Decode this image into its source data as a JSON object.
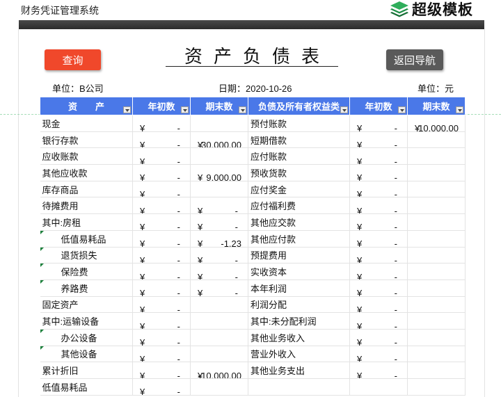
{
  "app": {
    "title": "财务凭证管理系统",
    "brand": "超级模板"
  },
  "buttons": {
    "query": "查询",
    "nav": "返回导航"
  },
  "document": {
    "title": "资产负债表",
    "unit_left": "单位：B公司",
    "date": "日期：2020-10-26",
    "unit_right": "单位：元"
  },
  "table": {
    "headers": [
      "资　　产",
      "年初数",
      "期末数",
      "负债及所有者权益类",
      "年初数",
      "期末数"
    ],
    "rows": [
      {
        "asset": "现金",
        "a_begin": [
          "¥",
          "-"
        ],
        "a_end": [
          "",
          ""
        ],
        "liab": "预付账款",
        "l_begin": [
          "¥",
          "-"
        ],
        "l_end": [
          "¥",
          "10,000.00"
        ]
      },
      {
        "asset": "银行存款",
        "a_begin": [
          "¥",
          "-"
        ],
        "a_end": [
          "¥",
          "30,000.00"
        ],
        "liab": "短期借款",
        "l_begin": [
          "¥",
          "-"
        ],
        "l_end": [
          "",
          ""
        ]
      },
      {
        "asset": "应收账款",
        "a_begin": [
          "¥",
          "-"
        ],
        "a_end": [
          "",
          ""
        ],
        "liab": "应付账款",
        "l_begin": [
          "¥",
          "-"
        ],
        "l_end": [
          "",
          ""
        ]
      },
      {
        "asset": "其他应收款",
        "a_begin": [
          "¥",
          "-"
        ],
        "a_end": [
          "¥",
          "9,000.00"
        ],
        "liab": "预收货款",
        "l_begin": [
          "¥",
          "-"
        ],
        "l_end": [
          "",
          ""
        ]
      },
      {
        "asset": "库存商品",
        "a_begin": [
          "¥",
          "-"
        ],
        "a_end": [
          "",
          ""
        ],
        "liab": "应付奖金",
        "l_begin": [
          "¥",
          "-"
        ],
        "l_end": [
          "",
          ""
        ]
      },
      {
        "asset": "待摊费用",
        "a_begin": [
          "¥",
          "-"
        ],
        "a_end": [
          "¥",
          "-"
        ],
        "liab": "应付福利费",
        "l_begin": [
          "¥",
          "-"
        ],
        "l_end": [
          "",
          ""
        ]
      },
      {
        "asset": "其中:房租",
        "a_begin": [
          "¥",
          "-"
        ],
        "a_end": [
          "¥",
          "-"
        ],
        "liab": "其他应交款",
        "l_begin": [
          "¥",
          "-"
        ],
        "l_end": [
          "",
          ""
        ]
      },
      {
        "asset": "低值易耗品",
        "a_begin": [
          "¥",
          "-"
        ],
        "a_end": [
          "¥",
          "-1.23"
        ],
        "liab": "其他应付款",
        "l_begin": [
          "¥",
          "-"
        ],
        "l_end": [
          "",
          ""
        ]
      },
      {
        "asset": "退货损失",
        "a_begin": [
          "¥",
          "-"
        ],
        "a_end": [
          "¥",
          "-"
        ],
        "liab": "预提费用",
        "l_begin": [
          "¥",
          "-"
        ],
        "l_end": [
          "",
          ""
        ]
      },
      {
        "asset": "保险费",
        "a_begin": [
          "¥",
          "-"
        ],
        "a_end": [
          "¥",
          "-"
        ],
        "liab": "实收资本",
        "l_begin": [
          "¥",
          "-"
        ],
        "l_end": [
          "",
          ""
        ]
      },
      {
        "asset": "养路费",
        "a_begin": [
          "¥",
          "-"
        ],
        "a_end": [
          "¥",
          "-"
        ],
        "liab": "本年利润",
        "l_begin": [
          "¥",
          "-"
        ],
        "l_end": [
          "",
          ""
        ]
      },
      {
        "asset": "固定资产",
        "a_begin": [
          "¥",
          "-"
        ],
        "a_end": [
          "",
          ""
        ],
        "liab": "利润分配",
        "l_begin": [
          "¥",
          "-"
        ],
        "l_end": [
          "",
          ""
        ]
      },
      {
        "asset": "其中:运输设备",
        "a_begin": [
          "¥",
          "-"
        ],
        "a_end": [
          "",
          ""
        ],
        "liab": "其中:未分配利润",
        "l_begin": [
          "¥",
          "-"
        ],
        "l_end": [
          "",
          ""
        ]
      },
      {
        "asset": "办公设备",
        "a_begin": [
          "¥",
          "-"
        ],
        "a_end": [
          "",
          ""
        ],
        "liab": "其他业务收入",
        "l_begin": [
          "¥",
          "-"
        ],
        "l_end": [
          "",
          ""
        ]
      },
      {
        "asset": "其他设备",
        "a_begin": [
          "¥",
          "-"
        ],
        "a_end": [
          "",
          ""
        ],
        "liab": "营业外收入",
        "l_begin": [
          "¥",
          "-"
        ],
        "l_end": [
          "",
          ""
        ]
      },
      {
        "asset": "累计折旧",
        "a_begin": [
          "¥",
          "-"
        ],
        "a_end": [
          "¥",
          "-10,000.00"
        ],
        "liab": "其他业务支出",
        "l_begin": [
          "¥",
          "-"
        ],
        "l_end": [
          "",
          ""
        ]
      },
      {
        "asset": "低值易耗品",
        "a_begin": [
          "¥",
          "-"
        ],
        "a_end": [
          "",
          ""
        ],
        "liab": "",
        "l_begin": [
          "",
          ""
        ],
        "l_end": [
          "",
          ""
        ]
      }
    ]
  }
}
